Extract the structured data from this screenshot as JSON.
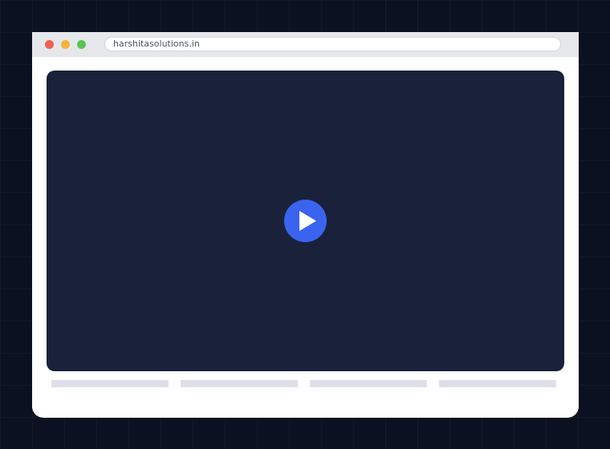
{
  "browser": {
    "url": "harshitasolutions.in",
    "controls": [
      {
        "name": "close",
        "color": "#ed5f57"
      },
      {
        "name": "minimize",
        "color": "#f5b33a"
      },
      {
        "name": "maximize",
        "color": "#5cc453"
      }
    ]
  },
  "video": {
    "background_color": "#19223a",
    "play_button_color": "#3a64f0",
    "play_icon": "play-triangle-icon",
    "play_icon_color": "#ffffff"
  },
  "placeholder_bars": {
    "count": 4,
    "color": "#dde0e8"
  }
}
